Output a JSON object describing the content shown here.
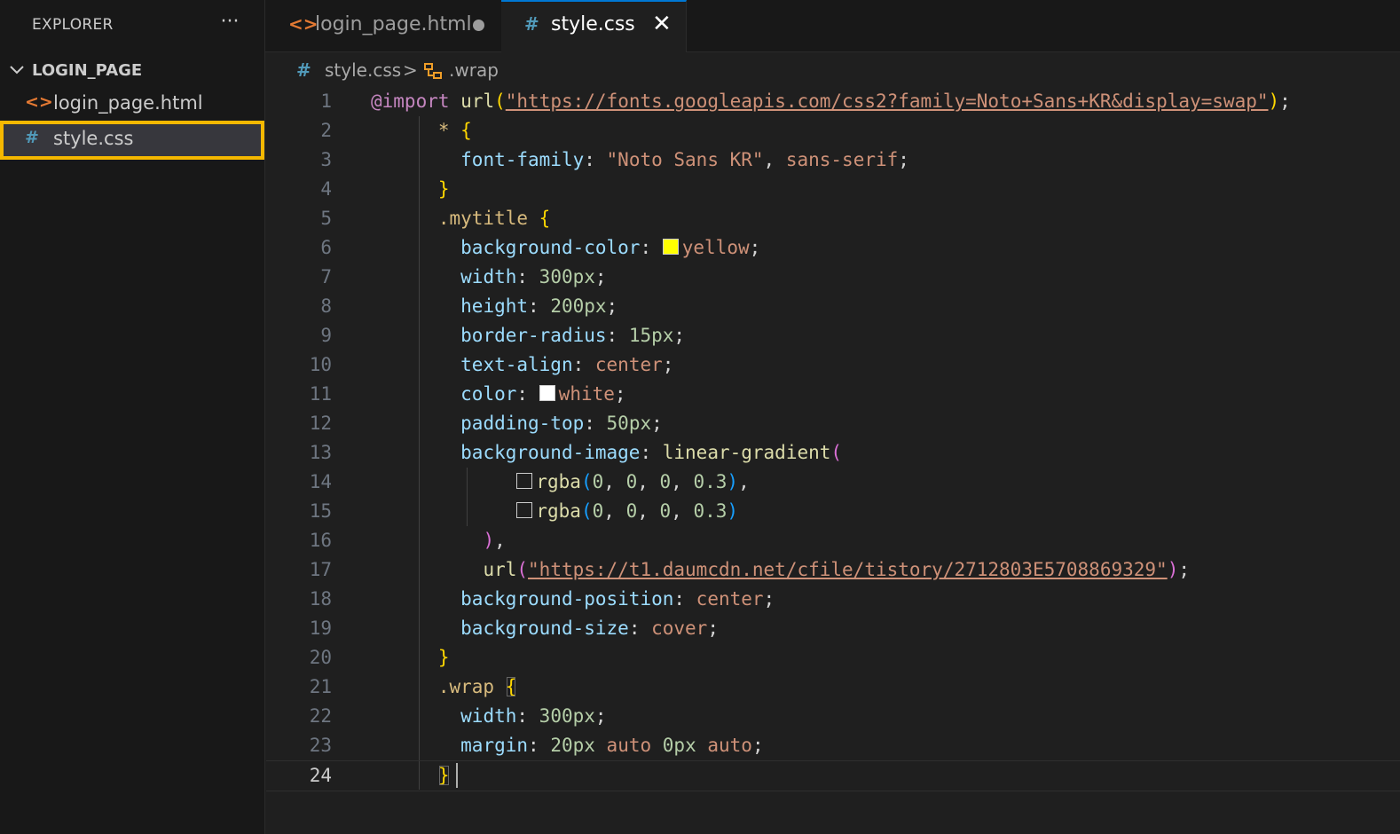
{
  "sidebar": {
    "header": "EXPLORER",
    "more": "···",
    "folder": "LOGIN_PAGE",
    "files": [
      {
        "label": "login_page.html",
        "icon": "<>"
      },
      {
        "label": "style.css",
        "icon": "#"
      }
    ]
  },
  "tabs": [
    {
      "label": "login_page.html",
      "icon": "<>"
    },
    {
      "label": "style.css",
      "icon": "#",
      "close": "✕"
    }
  ],
  "breadcrumb": {
    "file_icon": "#",
    "file": "style.css",
    "separator": ">",
    "symbol": ".wrap"
  },
  "editor": {
    "line_numbers": [
      "1",
      "2",
      "3",
      "4",
      "5",
      "6",
      "7",
      "8",
      "9",
      "10",
      "11",
      "12",
      "13",
      "14",
      "15",
      "16",
      "17",
      "18",
      "19",
      "20",
      "21",
      "22",
      "23",
      "24"
    ],
    "import_url": "\"https://fonts.googleapis.com/css2?family=Noto+Sans+KR&display=swap\"",
    "font_family_value": "\"Noto Sans KR\"",
    "bg_url": "\"https://t1.daumcdn.net/cfile/tistory/2712803E5708869329\""
  },
  "colors": {
    "accent": "#0078d4",
    "highlight": "#f5b800",
    "swatch_yellow": "#ffff00",
    "swatch_white": "#ffffff"
  },
  "icons": {
    "html_file": "html-file-icon",
    "css_file": "css-file-icon",
    "symbol": "symbol-class-icon"
  }
}
